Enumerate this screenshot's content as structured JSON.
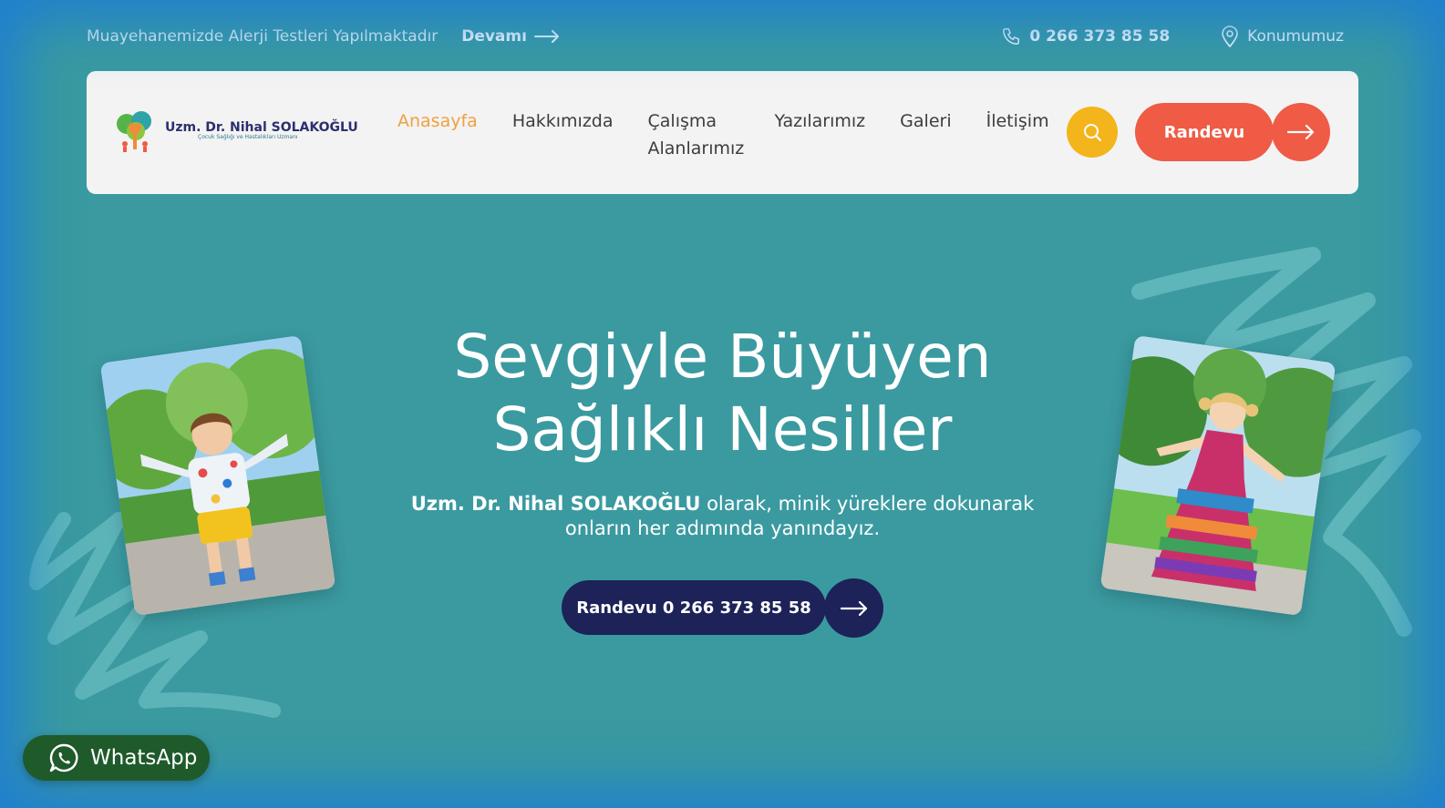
{
  "topbar": {
    "announcement": "Muayehanemizde Alerji Testleri Yapılmaktadır",
    "more_label": "Devamı",
    "phone": "0 266 373 85 58",
    "location_label": "Konumumuz"
  },
  "logo": {
    "name": "Uzm. Dr. Nihal SOLAKOĞLU",
    "tagline": "Çocuk Sağlığı ve Hastalıkları Uzmanı"
  },
  "nav": {
    "items": [
      {
        "label": "Anasayfa",
        "active": true
      },
      {
        "label": "Hakkımızda",
        "active": false
      },
      {
        "label": "Çalışma Alanlarımız",
        "active": false
      },
      {
        "label": "Yazılarımız",
        "active": false
      },
      {
        "label": "Galeri",
        "active": false
      },
      {
        "label": "İletişim",
        "active": false
      }
    ],
    "appointment_label": "Randevu"
  },
  "hero": {
    "title_line1": "Sevgiyle Büyüyen",
    "title_line2": "Sağlıklı Nesiller",
    "subtitle_name": "Uzm. Dr. Nihal SOLAKOĞLU",
    "subtitle_rest": " olarak, minik yüreklere dokunarak onların her adımında yanındayız.",
    "cta_label": "Randevu 0 266 373 85 58"
  },
  "whatsapp": {
    "label": "WhatsApp"
  },
  "colors": {
    "background": "#3a9aa0",
    "accent_orange": "#f0a040",
    "appointment_red": "#ef5b45",
    "search_yellow": "#f3b51b",
    "navy": "#1d2258",
    "whatsapp_green": "#1f5a2a"
  },
  "icons": {
    "more": "arrow-right-icon",
    "phone": "phone-icon",
    "location": "map-pin-icon",
    "search": "search-icon",
    "whatsapp": "whatsapp-icon"
  }
}
